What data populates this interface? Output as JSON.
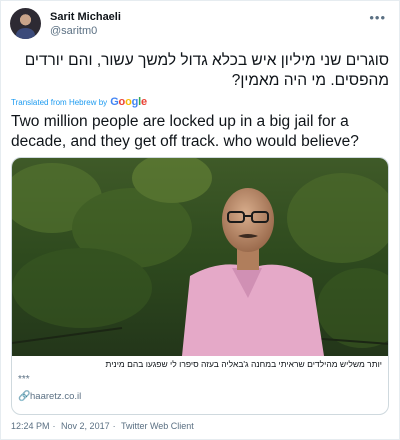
{
  "author": {
    "display_name": "Sarit Michaeli",
    "handle": "@saritm0",
    "more_icon": "more-dots-icon"
  },
  "tweet": {
    "text_original": "סוגרים שני מיליון איש בכלא גדול למשך עשור, והם יורדים מהפסים. מי היה מאמין?",
    "translated_label": "Translated from Hebrew by",
    "translator": "Google",
    "text_translated": "Two million people are locked up in a big jail for a decade, and they get off track. who would believe?"
  },
  "card": {
    "title": "יותר משליש מהילדים שראיתי במחנה ג'באליה בעזה סיפרו לי שפגעו בהם מינית",
    "description": "***",
    "link_icon": "link-icon",
    "domain": "haaretz.co.il"
  },
  "meta": {
    "time": "12:24 PM",
    "date": "Nov 2, 2017",
    "separator": "·",
    "client": "Twitter Web Client"
  },
  "colors": {
    "link_blue": "#1d9bf0",
    "secondary_text": "#5b7083",
    "border": "#cfd9de"
  }
}
